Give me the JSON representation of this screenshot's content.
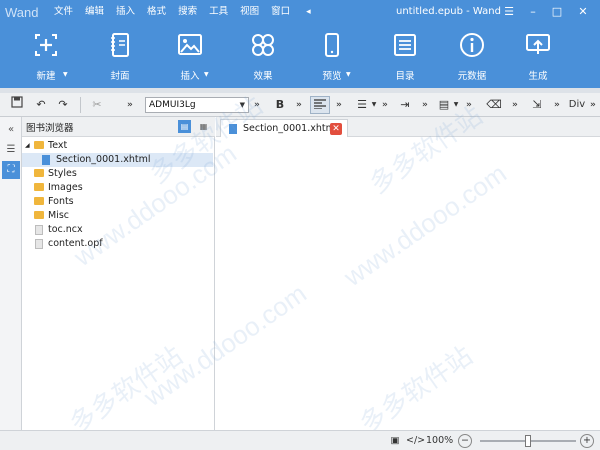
{
  "app": {
    "logo": "Wand",
    "document_title": "untitled.epub - Wand"
  },
  "menu": [
    "文件",
    "编辑",
    "插入",
    "格式",
    "搜索",
    "工具",
    "视图",
    "窗口"
  ],
  "ribbon": [
    {
      "label": "新建",
      "icon": "new-icon"
    },
    {
      "label": "封面",
      "icon": "cover-icon"
    },
    {
      "label": "插入",
      "icon": "insert-image-icon"
    },
    {
      "label": "效果",
      "icon": "effects-icon"
    },
    {
      "label": "预览",
      "icon": "preview-icon"
    },
    {
      "label": "目录",
      "icon": "toc-icon"
    },
    {
      "label": "元数据",
      "icon": "metadata-icon"
    },
    {
      "label": "生成",
      "icon": "generate-icon"
    }
  ],
  "toolbar": {
    "style_select": "ADMUI3Lg",
    "bold": "B",
    "div": "Div",
    "more": "»"
  },
  "panel": {
    "title": "图书浏览器",
    "tree": [
      {
        "label": "Text",
        "type": "folder",
        "expanded": true
      },
      {
        "label": "Section_0001.xhtml",
        "type": "xhtml",
        "selected": true
      },
      {
        "label": "Styles",
        "type": "folder"
      },
      {
        "label": "Images",
        "type": "folder"
      },
      {
        "label": "Fonts",
        "type": "folder"
      },
      {
        "label": "Misc",
        "type": "folder"
      },
      {
        "label": "toc.ncx",
        "type": "file"
      },
      {
        "label": "content.opf",
        "type": "file"
      }
    ]
  },
  "editor": {
    "tab_label": "Section_0001.xhtml",
    "close": "✕"
  },
  "watermark": [
    "多多软件站",
    "www.ddooo.com"
  ],
  "status": {
    "code_view": "</>",
    "zoom": "100%",
    "zoom_minus": "−",
    "zoom_plus": "+"
  },
  "colors": {
    "accent": "#4a90d9",
    "folder": "#f0b63c",
    "close": "#e24e3d"
  }
}
